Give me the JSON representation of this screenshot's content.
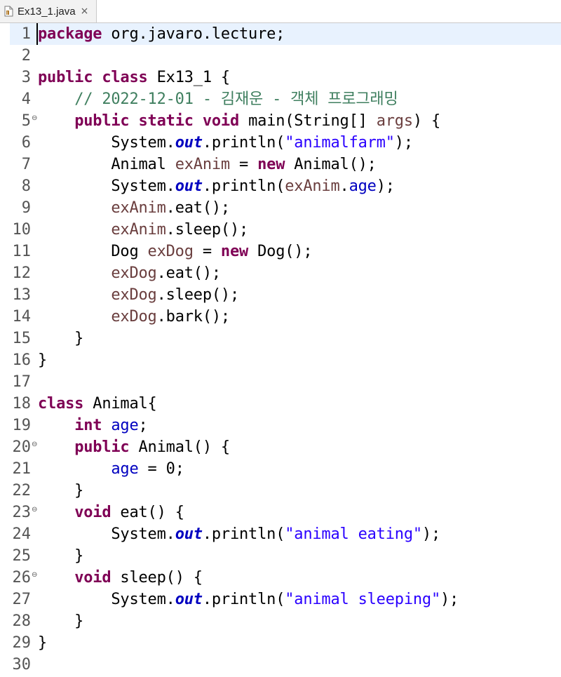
{
  "tab": {
    "icon": "java-file-icon",
    "title": "Ex13_1.java",
    "close_glyph": "×"
  },
  "colors": {
    "keyword": "#7f0055",
    "comment": "#3f7f5f",
    "string": "#2a00ff",
    "field": "#0000c0",
    "local_variable": "#6a3e3e",
    "current_line": "#e8f2fe"
  },
  "editor": {
    "current_line": 1,
    "lines": [
      {
        "n": "1",
        "tokens": [
          {
            "k": "kw",
            "v": "package"
          },
          {
            "k": "pl",
            "v": " org.javaro.lecture;"
          }
        ]
      },
      {
        "n": "2",
        "tokens": []
      },
      {
        "n": "3",
        "tokens": [
          {
            "k": "kw",
            "v": "public"
          },
          {
            "k": "pl",
            "v": " "
          },
          {
            "k": "kw",
            "v": "class"
          },
          {
            "k": "pl",
            "v": " Ex13_1 {"
          }
        ]
      },
      {
        "n": "4",
        "tokens": [
          {
            "k": "pl",
            "v": "    "
          },
          {
            "k": "cm",
            "v": "// 2022-12-01 - 김재운 - 객체 프로그래밍"
          }
        ]
      },
      {
        "n": "5",
        "fold": true,
        "tokens": [
          {
            "k": "pl",
            "v": "    "
          },
          {
            "k": "kw",
            "v": "public"
          },
          {
            "k": "pl",
            "v": " "
          },
          {
            "k": "kw",
            "v": "static"
          },
          {
            "k": "pl",
            "v": " "
          },
          {
            "k": "kw",
            "v": "void"
          },
          {
            "k": "pl",
            "v": " main(String[] "
          },
          {
            "k": "lv",
            "v": "args"
          },
          {
            "k": "pl",
            "v": ") {"
          }
        ]
      },
      {
        "n": "6",
        "tokens": [
          {
            "k": "pl",
            "v": "        System."
          },
          {
            "k": "fs",
            "v": "out"
          },
          {
            "k": "pl",
            "v": ".println("
          },
          {
            "k": "st",
            "v": "\"animalfarm\""
          },
          {
            "k": "pl",
            "v": ");"
          }
        ]
      },
      {
        "n": "7",
        "tokens": [
          {
            "k": "pl",
            "v": "        Animal "
          },
          {
            "k": "lv",
            "v": "exAnim"
          },
          {
            "k": "pl",
            "v": " = "
          },
          {
            "k": "kw",
            "v": "new"
          },
          {
            "k": "pl",
            "v": " Animal();"
          }
        ]
      },
      {
        "n": "8",
        "tokens": [
          {
            "k": "pl",
            "v": "        System."
          },
          {
            "k": "fs",
            "v": "out"
          },
          {
            "k": "pl",
            "v": ".println("
          },
          {
            "k": "lv",
            "v": "exAnim"
          },
          {
            "k": "pl",
            "v": "."
          },
          {
            "k": "fi",
            "v": "age"
          },
          {
            "k": "pl",
            "v": ");"
          }
        ]
      },
      {
        "n": "9",
        "tokens": [
          {
            "k": "pl",
            "v": "        "
          },
          {
            "k": "lv",
            "v": "exAnim"
          },
          {
            "k": "pl",
            "v": ".eat();"
          }
        ]
      },
      {
        "n": "10",
        "tokens": [
          {
            "k": "pl",
            "v": "        "
          },
          {
            "k": "lv",
            "v": "exAnim"
          },
          {
            "k": "pl",
            "v": ".sleep();"
          }
        ]
      },
      {
        "n": "11",
        "tokens": [
          {
            "k": "pl",
            "v": "        Dog "
          },
          {
            "k": "lv",
            "v": "exDog"
          },
          {
            "k": "pl",
            "v": " = "
          },
          {
            "k": "kw",
            "v": "new"
          },
          {
            "k": "pl",
            "v": " Dog();"
          }
        ]
      },
      {
        "n": "12",
        "tokens": [
          {
            "k": "pl",
            "v": "        "
          },
          {
            "k": "lv",
            "v": "exDog"
          },
          {
            "k": "pl",
            "v": ".eat();"
          }
        ]
      },
      {
        "n": "13",
        "tokens": [
          {
            "k": "pl",
            "v": "        "
          },
          {
            "k": "lv",
            "v": "exDog"
          },
          {
            "k": "pl",
            "v": ".sleep();"
          }
        ]
      },
      {
        "n": "14",
        "tokens": [
          {
            "k": "pl",
            "v": "        "
          },
          {
            "k": "lv",
            "v": "exDog"
          },
          {
            "k": "pl",
            "v": ".bark();"
          }
        ]
      },
      {
        "n": "15",
        "tokens": [
          {
            "k": "pl",
            "v": "    }"
          }
        ]
      },
      {
        "n": "16",
        "tokens": [
          {
            "k": "pl",
            "v": "}"
          }
        ]
      },
      {
        "n": "17",
        "tokens": []
      },
      {
        "n": "18",
        "tokens": [
          {
            "k": "kw",
            "v": "class"
          },
          {
            "k": "pl",
            "v": " Animal{"
          }
        ]
      },
      {
        "n": "19",
        "tokens": [
          {
            "k": "pl",
            "v": "    "
          },
          {
            "k": "kw",
            "v": "int"
          },
          {
            "k": "pl",
            "v": " "
          },
          {
            "k": "fi",
            "v": "age"
          },
          {
            "k": "pl",
            "v": ";"
          }
        ]
      },
      {
        "n": "20",
        "fold": true,
        "tokens": [
          {
            "k": "pl",
            "v": "    "
          },
          {
            "k": "kw",
            "v": "public"
          },
          {
            "k": "pl",
            "v": " Animal() {"
          }
        ]
      },
      {
        "n": "21",
        "tokens": [
          {
            "k": "pl",
            "v": "        "
          },
          {
            "k": "fi",
            "v": "age"
          },
          {
            "k": "pl",
            "v": " = 0;"
          }
        ]
      },
      {
        "n": "22",
        "tokens": [
          {
            "k": "pl",
            "v": "    }"
          }
        ]
      },
      {
        "n": "23",
        "fold": true,
        "tokens": [
          {
            "k": "pl",
            "v": "    "
          },
          {
            "k": "kw",
            "v": "void"
          },
          {
            "k": "pl",
            "v": " eat() {"
          }
        ]
      },
      {
        "n": "24",
        "tokens": [
          {
            "k": "pl",
            "v": "        System."
          },
          {
            "k": "fs",
            "v": "out"
          },
          {
            "k": "pl",
            "v": ".println("
          },
          {
            "k": "st",
            "v": "\"animal eating\""
          },
          {
            "k": "pl",
            "v": ");"
          }
        ]
      },
      {
        "n": "25",
        "tokens": [
          {
            "k": "pl",
            "v": "    }"
          }
        ]
      },
      {
        "n": "26",
        "fold": true,
        "tokens": [
          {
            "k": "pl",
            "v": "    "
          },
          {
            "k": "kw",
            "v": "void"
          },
          {
            "k": "pl",
            "v": " sleep() {"
          }
        ]
      },
      {
        "n": "27",
        "tokens": [
          {
            "k": "pl",
            "v": "        System."
          },
          {
            "k": "fs",
            "v": "out"
          },
          {
            "k": "pl",
            "v": ".println("
          },
          {
            "k": "st",
            "v": "\"animal sleeping\""
          },
          {
            "k": "pl",
            "v": ");"
          }
        ]
      },
      {
        "n": "28",
        "tokens": [
          {
            "k": "pl",
            "v": "    }"
          }
        ]
      },
      {
        "n": "29",
        "tokens": [
          {
            "k": "pl",
            "v": "}"
          }
        ]
      },
      {
        "n": "30",
        "tokens": []
      }
    ]
  }
}
